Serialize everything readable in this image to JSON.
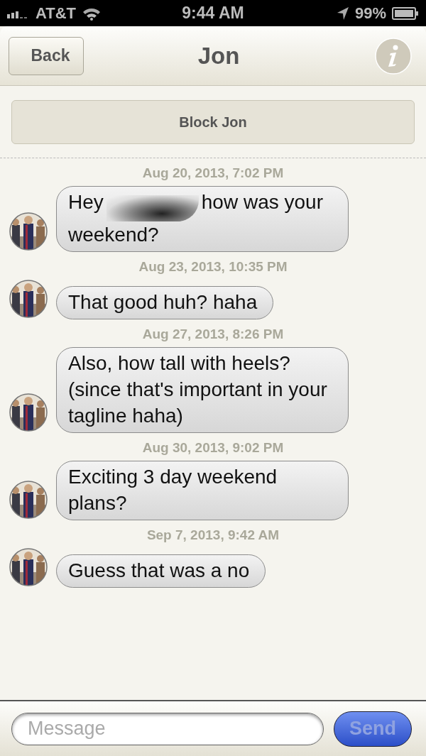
{
  "status_bar": {
    "carrier": "AT&T",
    "time": "9:44 AM",
    "battery": "99%"
  },
  "nav": {
    "back": "Back",
    "title": "Jon"
  },
  "block_button": "Block Jon",
  "thread": [
    {
      "kind": "timestamp",
      "text": "Aug 20, 2013, 7:02 PM"
    },
    {
      "kind": "message",
      "segments": [
        {
          "kind": "text",
          "text": "Hey"
        },
        {
          "kind": "redaction"
        },
        {
          "kind": "text",
          "text": "how was your weekend?"
        }
      ]
    },
    {
      "kind": "timestamp",
      "text": "Aug 23, 2013, 10:35 PM"
    },
    {
      "kind": "message",
      "segments": [
        {
          "kind": "text",
          "text": "That good huh? haha"
        }
      ]
    },
    {
      "kind": "timestamp",
      "text": "Aug 27, 2013, 8:26 PM"
    },
    {
      "kind": "message",
      "segments": [
        {
          "kind": "text",
          "text": "Also, how tall with heels? (since that's important in your tagline haha)"
        }
      ]
    },
    {
      "kind": "timestamp",
      "text": "Aug 30, 2013, 9:02 PM"
    },
    {
      "kind": "message",
      "segments": [
        {
          "kind": "text",
          "text": "Exciting 3 day weekend plans?"
        }
      ]
    },
    {
      "kind": "timestamp",
      "text": "Sep 7, 2013, 9:42 AM"
    },
    {
      "kind": "message",
      "segments": [
        {
          "kind": "text",
          "text": "Guess that was a no"
        }
      ]
    }
  ],
  "composer": {
    "placeholder": "Message",
    "send": "Send",
    "send_disabled": true
  }
}
